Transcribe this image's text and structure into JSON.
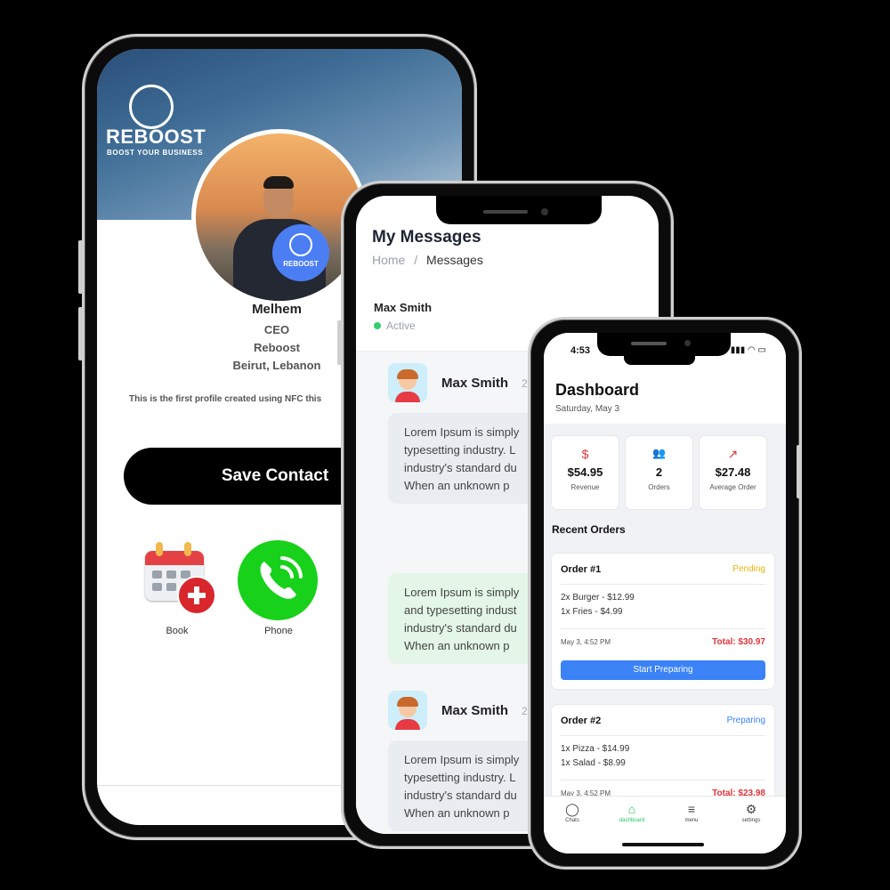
{
  "profile_app": {
    "brand_title": "REBOOST",
    "brand_tagline": "BOOST YOUR BUSINESS",
    "badge_text": "REBOOST",
    "name": "Melhem",
    "role": "CEO",
    "company": "Reboost",
    "location": "Beirut, Lebanon",
    "description": "This is the first profile created using NFC this",
    "save_contact_label": "Save Contact",
    "actions": [
      {
        "label": "Book",
        "icon": "calendar-add-icon"
      },
      {
        "label": "Phone",
        "icon": "phone-call-icon"
      }
    ],
    "colors": {
      "badge": "#4c7ef3",
      "phone": "#18d11a",
      "save_button": "#000000"
    }
  },
  "messages_app": {
    "title": "My Messages",
    "breadcrumb_home": "Home",
    "breadcrumb_separator": "/",
    "breadcrumb_current": "Messages",
    "chat_header": {
      "name": "Max Smith",
      "status": "Active"
    },
    "messages": [
      {
        "sender": "Max Smith",
        "time": "2",
        "lines": [
          "Lorem Ipsum is simply",
          "typesetting industry. L",
          "industry's standard du",
          "When an unknown p"
        ]
      },
      {
        "sender": "",
        "lines": [
          "Lorem Ipsum is simply",
          "and typesetting indust",
          "industry's standard du",
          "When an unknown p"
        ]
      },
      {
        "sender": "Max Smith",
        "time": "2",
        "lines": [
          "Lorem Ipsum is simply",
          "typesetting industry. L",
          "industry's standard du",
          "When an unknown p"
        ]
      }
    ]
  },
  "dashboard_app": {
    "status_time": "4:53",
    "title": "Dashboard",
    "date": "Saturday, May 3",
    "stats": [
      {
        "icon": "dollar-icon",
        "symbol": "$",
        "value": "$54.95",
        "label": "Revenue"
      },
      {
        "icon": "users-icon",
        "symbol": "👥",
        "value": "2",
        "label": "Orders"
      },
      {
        "icon": "trend-up-icon",
        "symbol": "↗",
        "value": "$27.48",
        "label": "Average Order"
      }
    ],
    "recent_orders_title": "Recent Orders",
    "orders": [
      {
        "title": "Order #1",
        "status": "Pending",
        "status_color": "#eab308",
        "items": [
          "2x Burger - $12.99",
          "1x Fries - $4.99"
        ],
        "date": "May 3, 4:52 PM",
        "total": "Total: $30.97",
        "action": "Start Preparing"
      },
      {
        "title": "Order #2",
        "status": "Preparing",
        "status_color": "#3b82f6",
        "items": [
          "1x Pizza - $14.99",
          "1x Salad - $8.99"
        ],
        "date": "May 3, 4:52 PM",
        "total": "Total: $23.98"
      }
    ],
    "tabs": [
      {
        "label": "Chats",
        "icon": "chat-icon",
        "active": false
      },
      {
        "label": "dashboard",
        "icon": "home-icon",
        "active": true
      },
      {
        "label": "menu",
        "icon": "menu-icon",
        "active": false
      },
      {
        "label": "settings",
        "icon": "gear-icon",
        "active": false
      }
    ]
  }
}
